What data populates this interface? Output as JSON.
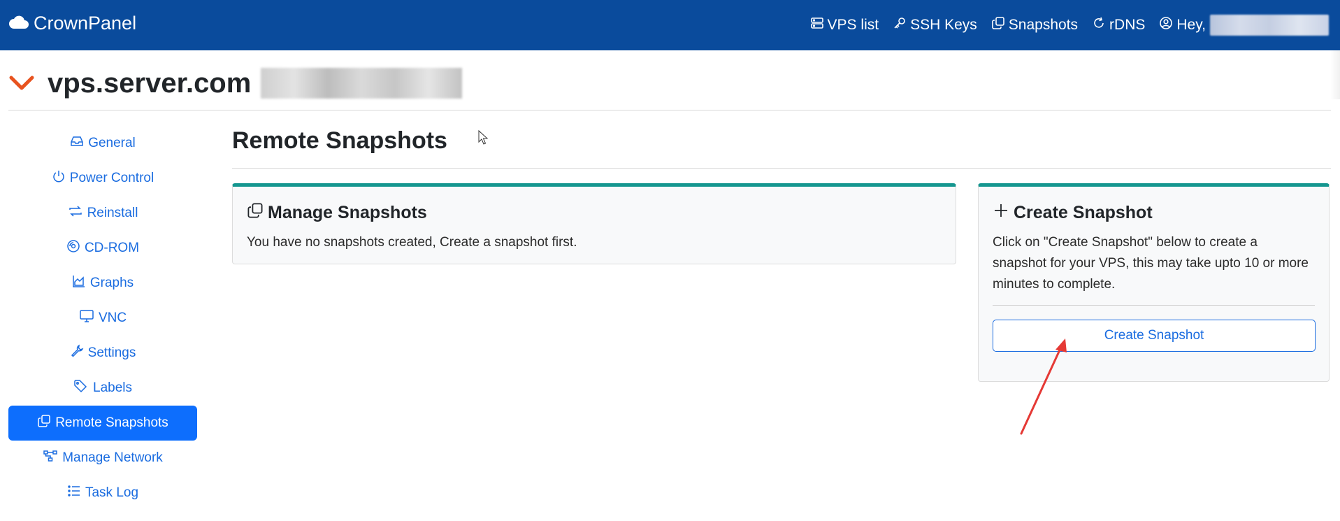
{
  "navbar": {
    "brand": "CrownPanel",
    "links": [
      {
        "label": "VPS list",
        "icon": "server-icon"
      },
      {
        "label": "SSH Keys",
        "icon": "key-icon"
      },
      {
        "label": "Snapshots",
        "icon": "copy-icon"
      },
      {
        "label": "rDNS",
        "icon": "refresh-icon"
      }
    ],
    "greeting": "Hey,"
  },
  "vps": {
    "hostname": "vps.server.com"
  },
  "sidebar": {
    "items": [
      {
        "label": "General",
        "icon": "inbox-icon"
      },
      {
        "label": "Power Control",
        "icon": "power-icon"
      },
      {
        "label": "Reinstall",
        "icon": "repeat-icon"
      },
      {
        "label": "CD-ROM",
        "icon": "disc-icon"
      },
      {
        "label": "Graphs",
        "icon": "area-chart-icon"
      },
      {
        "label": "VNC",
        "icon": "monitor-icon"
      },
      {
        "label": "Settings",
        "icon": "wrench-icon"
      },
      {
        "label": "Labels",
        "icon": "tags-icon"
      },
      {
        "label": "Remote Snapshots",
        "icon": "copy-icon",
        "active": true
      },
      {
        "label": "Manage Network",
        "icon": "diagram-icon"
      },
      {
        "label": "Task Log",
        "icon": "list-icon"
      }
    ]
  },
  "main": {
    "title": "Remote Snapshots",
    "manage_card": {
      "title": "Manage Snapshots",
      "text": "You have no snapshots created, Create a snapshot first."
    },
    "create_card": {
      "title": "Create Snapshot",
      "text": "Click on \"Create Snapshot\" below to create a snapshot for your VPS, this may take upto 10 or more minutes to complete.",
      "button_label": "Create Snapshot"
    }
  },
  "colors": {
    "navbar": "#0a4b9c",
    "accent": "#0d6efd",
    "link": "#1a6ce0",
    "card_top": "#14968f",
    "chevron": "#e8531f",
    "annotation_arrow": "#e53935"
  }
}
